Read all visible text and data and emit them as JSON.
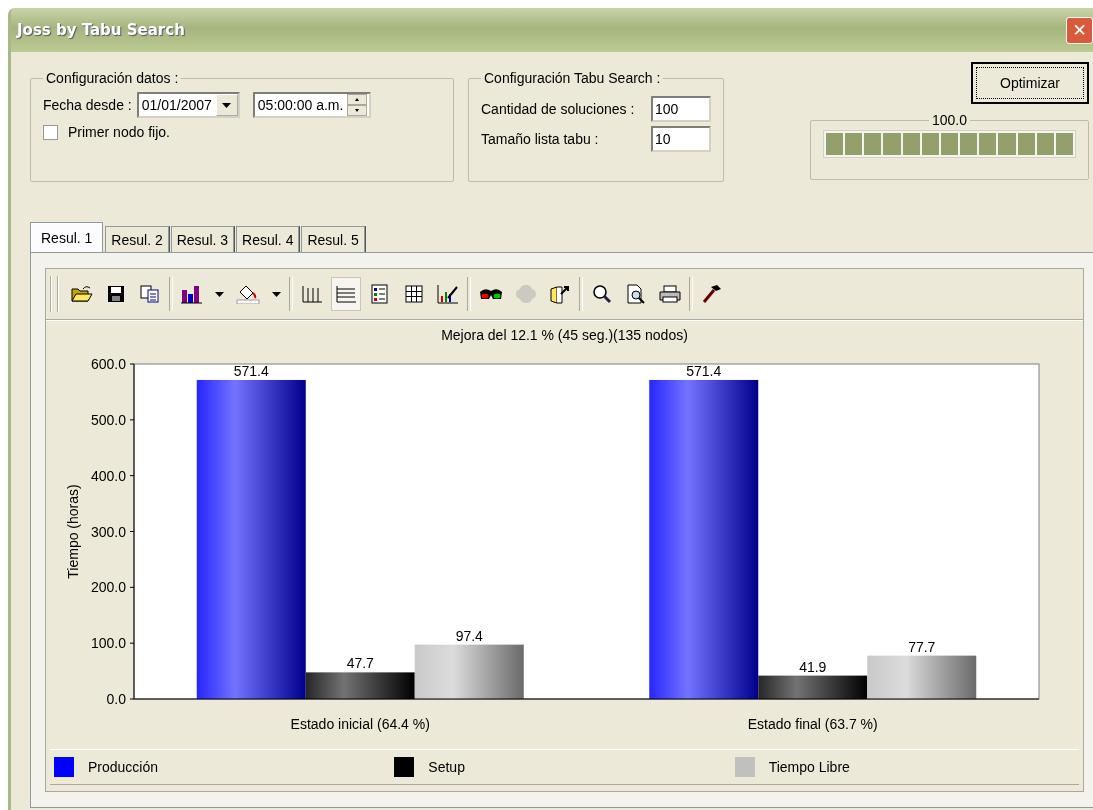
{
  "window": {
    "title": "Joss by Tabu Search",
    "close": "✕"
  },
  "config_data": {
    "legend": "Configuración datos :",
    "date_label": "Fecha desde :",
    "date_value": "01/01/2007",
    "time_value": "05:00:00 a.m.",
    "first_node_fixed": {
      "label": "Primer nodo fijo.",
      "checked": false
    }
  },
  "config_tabu": {
    "legend": "Configuración Tabu Search :",
    "fields": [
      {
        "label": "Cantidad de soluciones :",
        "value": "100"
      },
      {
        "label": "Tamaño lista tabu :",
        "value": "10"
      }
    ]
  },
  "optimize_button": "Optimizar",
  "progress": {
    "reading": "100.0",
    "level": 1.0
  },
  "tabs": [
    {
      "label": "Resul. 1",
      "selected": true
    },
    {
      "label": "Resul. 2",
      "selected": false
    },
    {
      "label": "Resul. 3",
      "selected": false
    },
    {
      "label": "Resul. 4",
      "selected": false
    },
    {
      "label": "Resul. 5",
      "selected": false
    }
  ],
  "toolbar": [
    {
      "kind": "open",
      "pressed": false,
      "disabled": false
    },
    {
      "kind": "save",
      "pressed": false,
      "disabled": false
    },
    {
      "kind": "copy",
      "pressed": false,
      "disabled": false
    },
    {
      "kind": "separator"
    },
    {
      "kind": "chart",
      "pressed": false,
      "disabled": false
    },
    {
      "kind": "dropdown",
      "pressed": false,
      "disabled": false
    },
    {
      "kind": "paint",
      "pressed": false,
      "disabled": false
    },
    {
      "kind": "dropdown",
      "pressed": false,
      "disabled": false
    },
    {
      "kind": "separator"
    },
    {
      "kind": "vgrid",
      "pressed": false,
      "disabled": false
    },
    {
      "kind": "hgrid",
      "pressed": true,
      "disabled": false
    },
    {
      "kind": "legend",
      "pressed": false,
      "disabled": false
    },
    {
      "kind": "table",
      "pressed": false,
      "disabled": false
    },
    {
      "kind": "style",
      "pressed": false,
      "disabled": false
    },
    {
      "kind": "separator"
    },
    {
      "kind": "glasses",
      "pressed": false,
      "disabled": false
    },
    {
      "kind": "blob",
      "pressed": false,
      "disabled": true
    },
    {
      "kind": "export",
      "pressed": false,
      "disabled": false
    },
    {
      "kind": "separator"
    },
    {
      "kind": "zoom",
      "pressed": false,
      "disabled": false
    },
    {
      "kind": "preview",
      "pressed": false,
      "disabled": false
    },
    {
      "kind": "print",
      "pressed": false,
      "disabled": false
    },
    {
      "kind": "separator"
    },
    {
      "kind": "hammer",
      "pressed": false,
      "disabled": false
    }
  ],
  "chart_data": {
    "type": "bar",
    "title": "Mejora del 12.1 % (45 seg.)(135 nodos)",
    "ylabel": "Tiempo (horas)",
    "categories": [
      "Estado inicial (64.4 %)",
      "Estado final (63.7 %)"
    ],
    "series": [
      {
        "name": "Producción",
        "color": "#0000ff",
        "values": [
          571.4,
          571.4
        ]
      },
      {
        "name": "Setup",
        "color": "#000000",
        "values": [
          47.7,
          41.9
        ]
      },
      {
        "name": "Tiempo Libre",
        "color": "#c0c0c0",
        "values": [
          97.4,
          77.7
        ]
      }
    ],
    "ylim": [
      0,
      600
    ],
    "yticks": [
      {
        "value": 0,
        "label": "0.0"
      },
      {
        "value": 100,
        "label": "100.0"
      },
      {
        "value": 200,
        "label": "200.0"
      },
      {
        "value": 300,
        "label": "300.0"
      },
      {
        "value": 400,
        "label": "400.0"
      },
      {
        "value": 500,
        "label": "500.0"
      },
      {
        "value": 600,
        "label": "600.0"
      }
    ],
    "data_labels": true
  }
}
